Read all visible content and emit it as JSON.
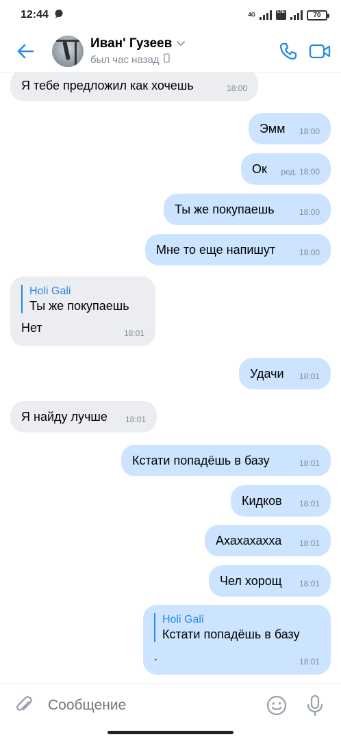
{
  "status_bar": {
    "time": "12:44",
    "network_badge_top": "4G",
    "network_badge_bottom": "LTE",
    "battery": "70",
    "icons": [
      "chat-bubble-icon",
      "signal-icon",
      "volte-icon",
      "signal-icon",
      "battery-icon"
    ]
  },
  "header": {
    "name": "Иван' Гузеев",
    "last_seen": "был час назад",
    "icons": [
      "back-arrow-icon",
      "chevron-down-icon",
      "phone-device-icon",
      "phone-call-icon",
      "video-call-icon"
    ],
    "accent": "#2688eb"
  },
  "messages": [
    {
      "dir": "in",
      "text": "Я тебе предложил как хочешь",
      "time": "18:00"
    },
    {
      "dir": "out",
      "text": "Эмм",
      "time": "18:00"
    },
    {
      "dir": "out",
      "text": "Ок",
      "time": "ред. 18:00"
    },
    {
      "dir": "out",
      "text": "Ты же покупаешь",
      "time": "18:00"
    },
    {
      "dir": "out",
      "text": "Мне то еще напишут",
      "time": "18:00"
    },
    {
      "dir": "in",
      "reply_name": "Holi Gali",
      "reply_text": "Ты же покупаешь",
      "text": "Нет",
      "time": "18:01"
    },
    {
      "dir": "out",
      "text": "Удачи",
      "time": "18:01"
    },
    {
      "dir": "in",
      "text": "Я найду лучше",
      "time": "18:01"
    },
    {
      "dir": "out",
      "text": "Кстати попадёшь в базу",
      "time": "18:01"
    },
    {
      "dir": "out",
      "text": "Кидков",
      "time": "18:01"
    },
    {
      "dir": "out",
      "text": "Ахахахахха",
      "time": "18:01"
    },
    {
      "dir": "out",
      "text": "Чел хорощ",
      "time": "18:01"
    },
    {
      "dir": "out",
      "reply_name": "Holi Gali",
      "reply_text": "Кстати попадёшь в базу",
      "text": ".",
      "time": "18:01"
    }
  ],
  "composer": {
    "placeholder": "Сообщение",
    "icons": [
      "paperclip-icon",
      "smile-icon",
      "microphone-icon"
    ]
  },
  "colors": {
    "incoming_bubble": "#ebedf0",
    "outgoing_bubble": "#cce4ff",
    "secondary_text": "#818c99"
  }
}
